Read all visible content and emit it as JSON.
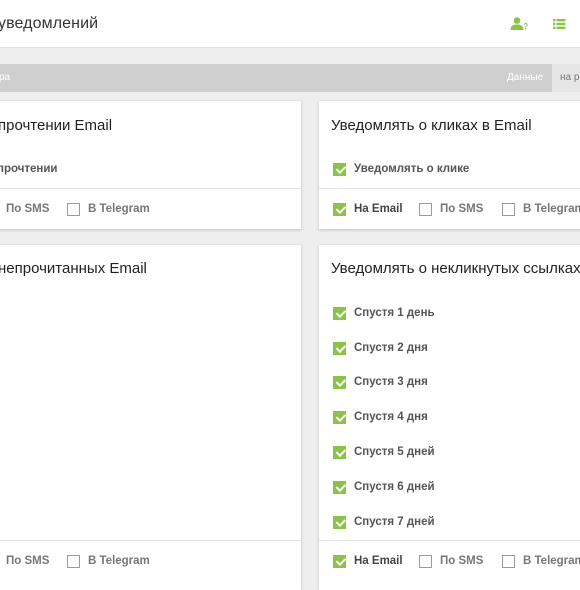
{
  "header": {
    "title": "уведомлений",
    "user_help_icon": "user-help-icon",
    "list_icon": "list-icon",
    "accent_color": "#8bc34a"
  },
  "bar": {
    "left_text": "ра",
    "data_label": "Данные",
    "tab_label": "на р"
  },
  "cards": {
    "read": {
      "title": "прочтении Email",
      "option": "прочтении",
      "footer": {
        "sms": "По SMS",
        "telegram": "В Telegram"
      }
    },
    "clicks": {
      "title": "Уведомлять о кликах в Email",
      "option": "Уведомлять о клике",
      "footer": {
        "email": "На Email",
        "sms": "По SMS",
        "telegram": "В Telegram"
      }
    },
    "unread": {
      "title": "непрочитанных Email",
      "footer": {
        "sms": "По SMS",
        "telegram": "В Telegram"
      }
    },
    "unclicked": {
      "title": "Уведомлять о некликнутых ссылках",
      "options": [
        "Спустя 1 день",
        "Спустя 2 дня",
        "Спустя 3 дня",
        "Спустя 4 дня",
        "Спустя 5 дней",
        "Спустя 6 дней",
        "Спустя 7 дней"
      ],
      "footer": {
        "email": "На Email",
        "sms": "По SMS",
        "telegram": "В Telegram"
      }
    }
  }
}
